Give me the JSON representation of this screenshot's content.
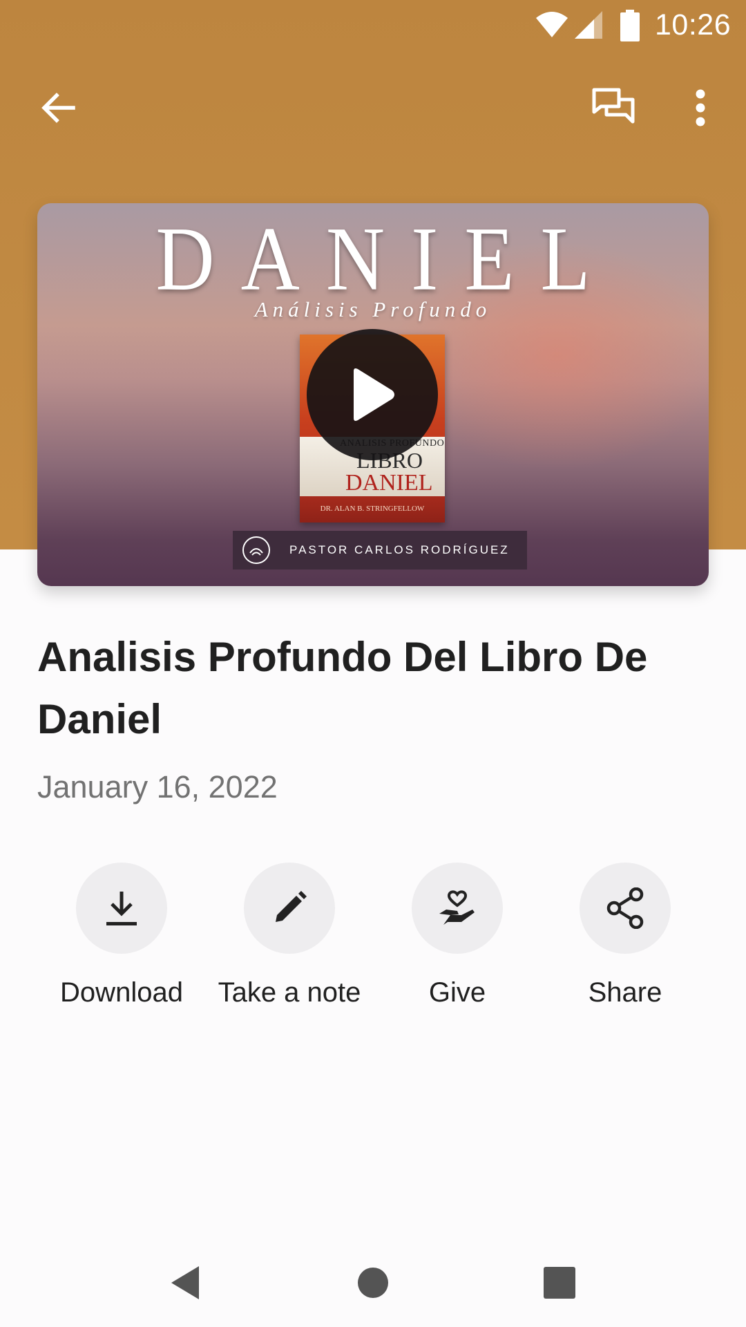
{
  "status_bar": {
    "time": "10:26"
  },
  "toolbar": {
    "back_icon": "arrow-left-icon",
    "chat_icon": "chat-bubbles-icon",
    "more_icon": "more-vert-icon"
  },
  "video": {
    "thumbnail_title": "DANIEL",
    "thumbnail_subtitle": "Análisis Profundo",
    "book": {
      "line1": "ANALISIS PROFUNDO",
      "line2": "LIBRO",
      "line3": "DANIEL",
      "author": "DR. ALAN B. STRINGFELLOW"
    },
    "speaker": "PASTOR CARLOS RODRÍGUEZ",
    "play_icon": "play-icon"
  },
  "media": {
    "title": "Analisis Profundo Del Libro De Daniel",
    "date": "January 16, 2022"
  },
  "actions": [
    {
      "label": "Download",
      "icon": "download-icon"
    },
    {
      "label": "Take a note",
      "icon": "pencil-icon"
    },
    {
      "label": "Give",
      "icon": "hand-heart-icon"
    },
    {
      "label": "Share",
      "icon": "share-icon"
    }
  ],
  "colors": {
    "header": "#c18a43",
    "background": "#fcfbfc",
    "action_circle": "#eeedef"
  }
}
